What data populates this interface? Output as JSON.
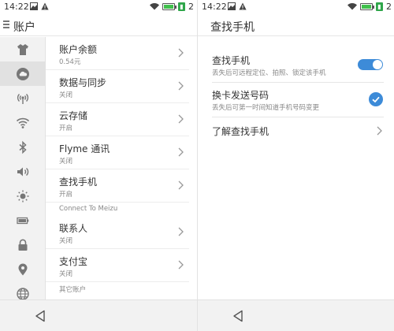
{
  "status_left": {
    "time": "14:22",
    "sim": "2"
  },
  "status_right": {
    "time": "14:22",
    "sim": "2"
  },
  "left": {
    "title": "账户",
    "rail_icons": [
      "shirt-icon",
      "cloud-icon",
      "hotspot-icon",
      "wifi-icon",
      "bluetooth-icon",
      "volume-icon",
      "brightness-icon",
      "battery-icon",
      "lock-icon",
      "location-icon",
      "globe-icon"
    ],
    "rows": [
      {
        "label": "账户余额",
        "sub": "0.54元"
      },
      {
        "label": "数据与同步",
        "sub": "关闭"
      },
      {
        "label": "云存储",
        "sub": "开启"
      },
      {
        "label": "Flyme 通讯",
        "sub": "关闭"
      },
      {
        "label": "查找手机",
        "sub": "开启"
      },
      {
        "label": "联系人",
        "sub": "关闭"
      },
      {
        "label": "支付宝",
        "sub": "关闭"
      }
    ],
    "section_meizu": "Connect To Meizu",
    "section_other": "其它账户"
  },
  "right": {
    "title": "查找手机",
    "find_phone": {
      "label": "查找手机",
      "sub": "丢失后可远程定位、拍照、锁定该手机",
      "enabled": true
    },
    "sim_change": {
      "label": "换卡发送号码",
      "sub": "丢失后可第一时间知道手机号码变更",
      "checked": true
    },
    "learn_more": {
      "label": "了解查找手机"
    }
  },
  "colors": {
    "accent": "#3d8bd8",
    "battery": "#41c14d",
    "sim_chip": "#2fa64a"
  }
}
